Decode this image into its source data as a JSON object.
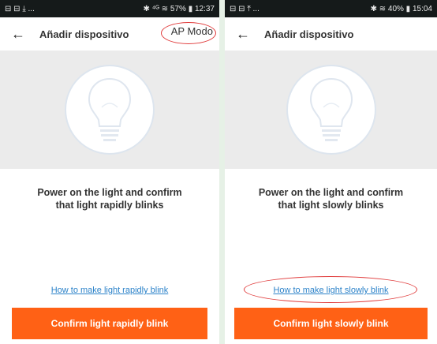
{
  "screens": [
    {
      "status": {
        "left_icons": "⊟ ⊟ ⤓ ...",
        "right": "✱ ⁴ᴳ ≋ 57% ▮ 12:37"
      },
      "appbar": {
        "back_glyph": "←",
        "title": "Añadir dispositivo",
        "action": "AP Modo"
      },
      "instruction": [
        "Power on the light and confirm",
        "that light rapidly blinks"
      ],
      "help_link": "How to make light rapidly blink",
      "button": "Confirm light rapidly blink"
    },
    {
      "status": {
        "left_icons": "⊟ ⊟ ⤒ ...",
        "right": "✱ ≋ 40% ▮ 15:04"
      },
      "appbar": {
        "back_glyph": "←",
        "title": "Añadir dispositivo"
      },
      "instruction": [
        "Power on the light and confirm",
        "that light slowly blinks"
      ],
      "help_link": "How to make light slowly blink",
      "button": "Confirm light slowly blink"
    }
  ],
  "colors": {
    "accent": "#ff6115",
    "link": "#2b82c9",
    "annotation": "#e03a3a",
    "statusbar": "#151a1a"
  },
  "icons": [
    "back-arrow-icon",
    "light-bulb-icon",
    "battery-icon",
    "signal-icon",
    "bluetooth-icon"
  ]
}
